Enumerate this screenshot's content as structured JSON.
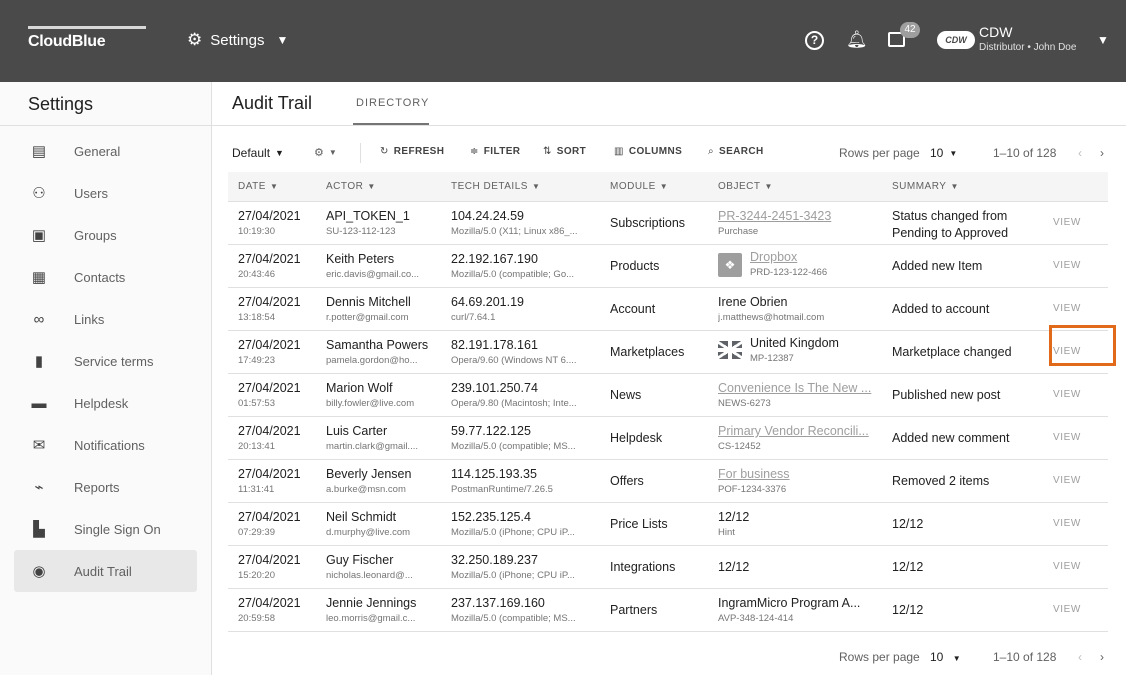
{
  "topbar": {
    "logo": "CloudBlue",
    "section": "Settings",
    "messages_count": "42",
    "account_logo": "CDW",
    "account_name": "CDW",
    "account_sub": "Distributor • John Doe"
  },
  "sidebar": {
    "title": "Settings",
    "items": [
      {
        "label": "General",
        "icon": "clipboard-icon"
      },
      {
        "label": "Users",
        "icon": "users-icon"
      },
      {
        "label": "Groups",
        "icon": "folder-users-icon"
      },
      {
        "label": "Contacts",
        "icon": "contacts-icon"
      },
      {
        "label": "Links",
        "icon": "link-icon"
      },
      {
        "label": "Service terms",
        "icon": "document-icon"
      },
      {
        "label": "Helpdesk",
        "icon": "chat-icon"
      },
      {
        "label": "Notifications",
        "icon": "mail-icon"
      },
      {
        "label": "Reports",
        "icon": "chart-icon"
      },
      {
        "label": "Single Sign On",
        "icon": "sso-icon"
      },
      {
        "label": "Audit Trail",
        "icon": "shield-icon",
        "active": true
      }
    ]
  },
  "header": {
    "title": "Audit Trail",
    "tab": "DIRECTORY"
  },
  "toolbar": {
    "view": "Default",
    "refresh": "REFRESH",
    "filter": "FILTER",
    "sort": "SORT",
    "columns": "COLUMNS",
    "search": "SEARCH",
    "rows_label": "Rows per page",
    "rows_value": "10",
    "range": "1–10 of 128"
  },
  "table": {
    "columns": [
      "DATE",
      "ACTOR",
      "TECH DETAILS",
      "MODULE",
      "OBJECT",
      "SUMMARY"
    ],
    "view_label": "VIEW",
    "rows": [
      {
        "date": "27/04/2021",
        "time": "10:19:30",
        "actor": "API_TOKEN_1",
        "actor_sub": "SU-123-112-123",
        "ip": "104.24.24.59",
        "agent": "Mozilla/5.0 (X11; Linux x86_...",
        "module": "Subscriptions",
        "object": "PR-3244-2451-3423",
        "object_sub": "Purchase",
        "summary": "Status changed from",
        "summary2": "Pending to Approved"
      },
      {
        "date": "27/04/2021",
        "time": "20:43:46",
        "actor": "Keith Peters",
        "actor_sub": "eric.davis@gmail.co...",
        "ip": "22.192.167.190",
        "agent": "Mozilla/5.0 (compatible; Go...",
        "module": "Products",
        "object": "Dropbox",
        "object_sub": "PRD-123-122-466",
        "summary": "Added new Item"
      },
      {
        "date": "27/04/2021",
        "time": "13:18:54",
        "actor": "Dennis Mitchell",
        "actor_sub": "r.potter@gmail.com",
        "ip": "64.69.201.19",
        "agent": "curl/7.64.1",
        "module": "Account",
        "object": "Irene Obrien",
        "object_sub": "j.matthews@hotmail.com",
        "summary": "Added to account"
      },
      {
        "date": "27/04/2021",
        "time": "17:49:23",
        "actor": "Samantha Powers",
        "actor_sub": "pamela.gordon@ho...",
        "ip": "82.191.178.161",
        "agent": "Opera/9.60 (Windows NT 6....",
        "module": "Marketplaces",
        "object": "United Kingdom",
        "object_sub": "MP-12387",
        "summary": "Marketplace changed"
      },
      {
        "date": "27/04/2021",
        "time": "01:57:53",
        "actor": "Marion Wolf",
        "actor_sub": "billy.fowler@live.com",
        "ip": "239.101.250.74",
        "agent": "Opera/9.80 (Macintosh; Inte...",
        "module": "News",
        "object": "Convenience Is The New ...",
        "object_sub": "NEWS-6273",
        "summary": "Published new post"
      },
      {
        "date": "27/04/2021",
        "time": "20:13:41",
        "actor": "Luis Carter",
        "actor_sub": "martin.clark@gmail....",
        "ip": "59.77.122.125",
        "agent": "Mozilla/5.0 (compatible; MS...",
        "module": "Helpdesk",
        "object": "Primary Vendor Reconcili...",
        "object_sub": "CS-12452",
        "summary": "Added new comment"
      },
      {
        "date": "27/04/2021",
        "time": "11:31:41",
        "actor": "Beverly Jensen",
        "actor_sub": "a.burke@msn.com",
        "ip": "114.125.193.35",
        "agent": "PostmanRuntime/7.26.5",
        "module": "Offers",
        "object": "For business",
        "object_sub": "POF-1234-3376",
        "summary": "Removed 2 items"
      },
      {
        "date": "27/04/2021",
        "time": "07:29:39",
        "actor": "Neil Schmidt",
        "actor_sub": "d.murphy@live.com",
        "ip": "152.235.125.4",
        "agent": "Mozilla/5.0 (iPhone; CPU iP...",
        "module": "Price Lists",
        "object": "12/12",
        "object_sub": "Hint",
        "summary": "12/12"
      },
      {
        "date": "27/04/2021",
        "time": "15:20:20",
        "actor": "Guy Fischer",
        "actor_sub": "nicholas.leonard@...",
        "ip": "32.250.189.237",
        "agent": "Mozilla/5.0 (iPhone; CPU iP...",
        "module": "Integrations",
        "object": "12/12",
        "summary": "12/12"
      },
      {
        "date": "27/04/2021",
        "time": "20:59:58",
        "actor": "Jennie Jennings",
        "actor_sub": "leo.morris@gmail.c...",
        "ip": "237.137.169.160",
        "agent": "Mozilla/5.0 (compatible; MS...",
        "module": "Partners",
        "object": "IngramMicro Program A...",
        "object_sub": "AVP-348-124-414",
        "summary": "12/12"
      }
    ]
  },
  "footer": {
    "rows_label": "Rows per page",
    "rows_value": "10",
    "range": "1–10 of 128"
  }
}
